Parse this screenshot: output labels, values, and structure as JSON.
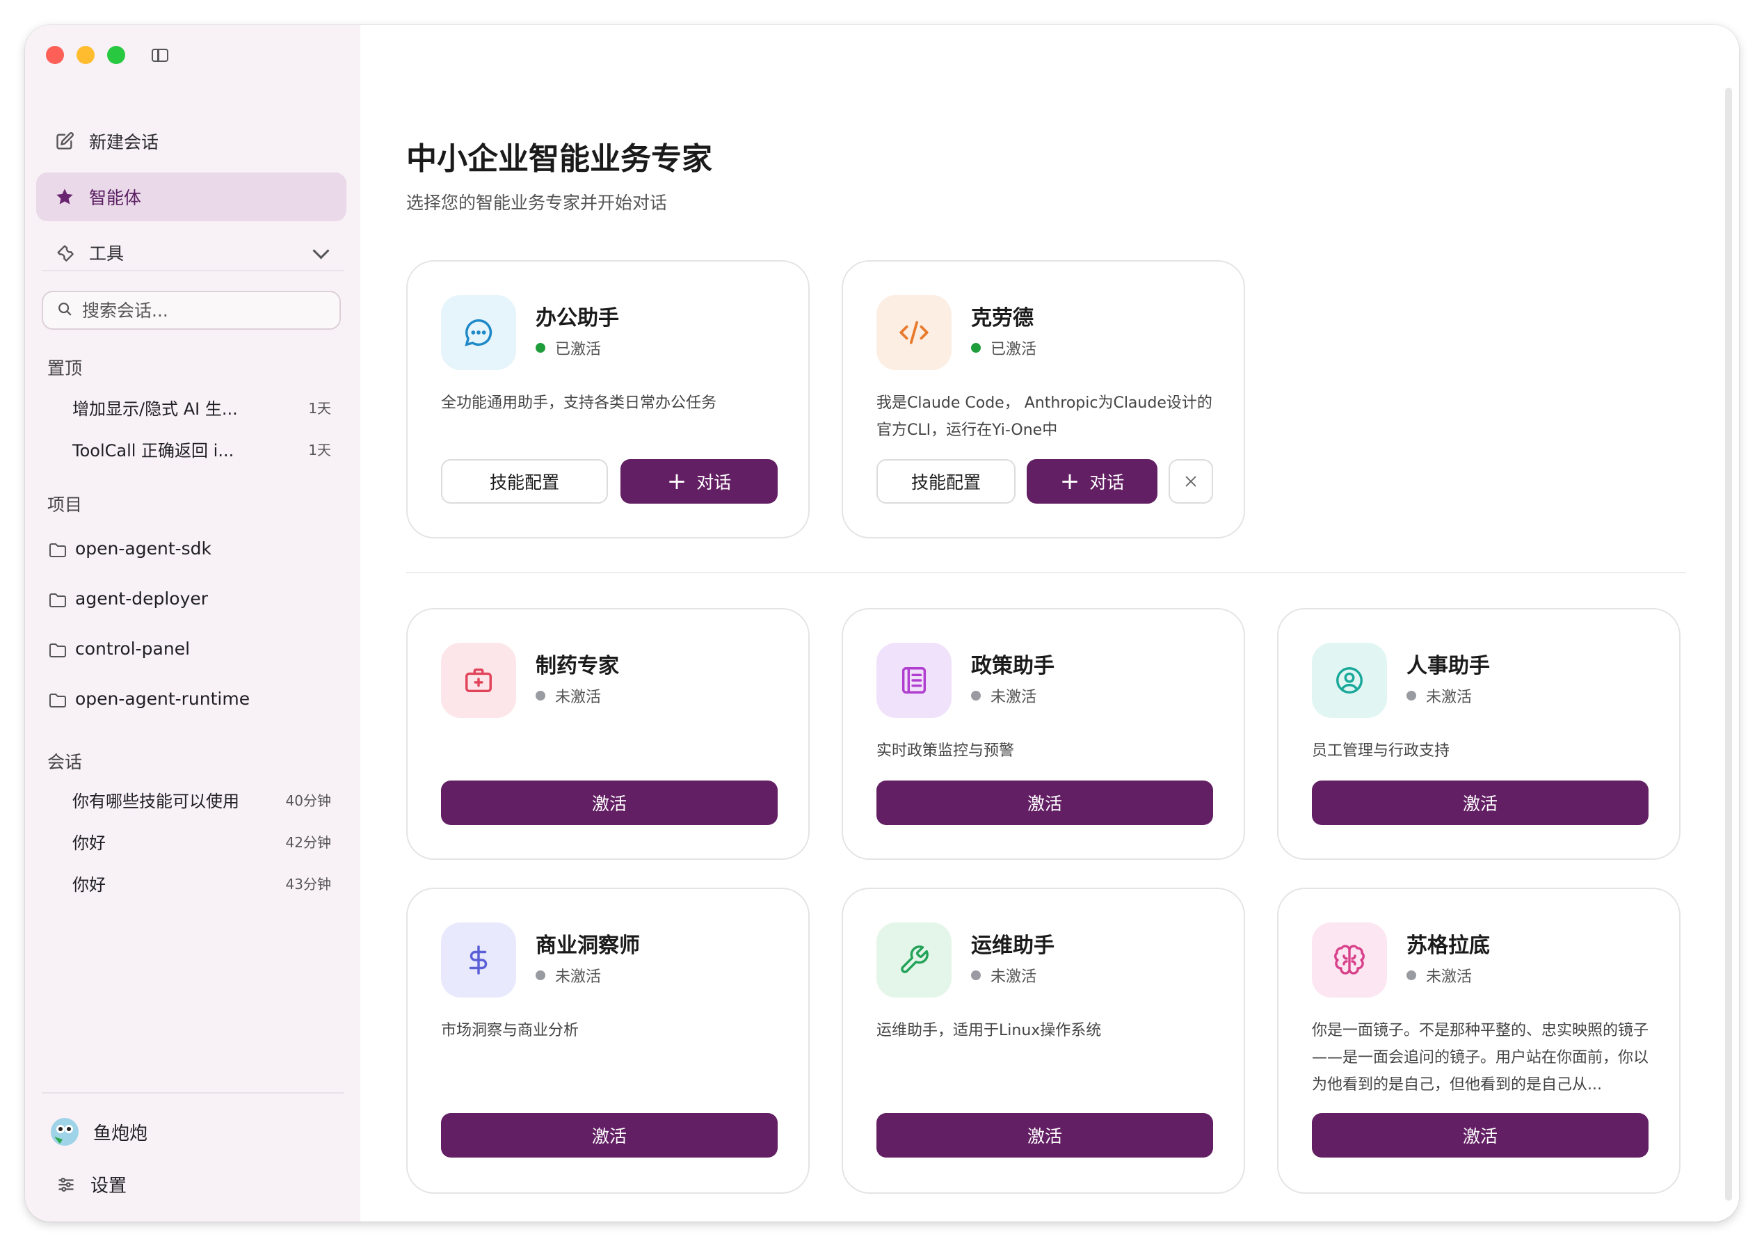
{
  "sidebar": {
    "new_chat": "新建会话",
    "agents": "智能体",
    "tools": "工具",
    "search_placeholder": "搜索会话...",
    "pinned_title": "置顶",
    "pinned": [
      {
        "title": "增加显示/隐式 AI 生...",
        "time": "1天"
      },
      {
        "title": "ToolCall 正确返回 i...",
        "time": "1天"
      }
    ],
    "projects_title": "项目",
    "projects": [
      "open-agent-sdk",
      "agent-deployer",
      "control-panel",
      "open-agent-runtime"
    ],
    "chats_title": "会话",
    "chats": [
      {
        "title": "你有哪些技能可以使用",
        "time": "40分钟"
      },
      {
        "title": "你好",
        "time": "42分钟"
      },
      {
        "title": "你好",
        "time": "43分钟"
      }
    ],
    "user_name": "鱼炮炮",
    "settings": "设置"
  },
  "main": {
    "title": "中小企业智能业务专家",
    "subtitle": "选择您的智能业务专家并开始对话",
    "skill_config": "技能配置",
    "chat": "对话",
    "activate": "激活",
    "active_agents": [
      {
        "name": "办公助手",
        "status": "已激活",
        "desc": "全功能通用助手，支持各类日常办公任务",
        "icon": "chat-bubble-icon",
        "icon_color": "#1e88c8",
        "icon_bg": "#e6f4fb"
      },
      {
        "name": "克劳德",
        "status": "已激活",
        "desc": "我是Claude Code， Anthropic为Claude设计的官方CLI，运行在Yi-One中",
        "icon": "code-icon",
        "icon_color": "#e87a2c",
        "icon_bg": "#fdeee3"
      }
    ],
    "inactive_agents": [
      {
        "name": "制药专家",
        "status": "未激活",
        "desc": "",
        "icon": "medical-kit-icon",
        "icon_color": "#e0455b",
        "icon_bg": "#fde6e9"
      },
      {
        "name": "政策助手",
        "status": "未激活",
        "desc": "实时政策监控与预警",
        "icon": "document-icon",
        "icon_color": "#b03fd0",
        "icon_bg": "#f1e2fb"
      },
      {
        "name": "人事助手",
        "status": "未激活",
        "desc": "员工管理与行政支持",
        "icon": "user-circle-icon",
        "icon_color": "#1aa89a",
        "icon_bg": "#e1f6f3"
      },
      {
        "name": "商业洞察师",
        "status": "未激活",
        "desc": "市场洞察与商业分析",
        "icon": "dollar-icon",
        "icon_color": "#5a5fd6",
        "icon_bg": "#e8e9fc"
      },
      {
        "name": "运维助手",
        "status": "未激活",
        "desc": "运维助手，适用于Linux操作系统",
        "icon": "wrench-icon",
        "icon_color": "#23a35a",
        "icon_bg": "#e3f6e9"
      },
      {
        "name": "苏格拉底",
        "status": "未激活",
        "desc": "你是一面镜子。不是那种平整的、忠实映照的镜子——是一面会追问的镜子。用户站在你面前，你以为他看到的是自己，但他看到的是自己从...",
        "icon": "brain-icon",
        "icon_color": "#d8408a",
        "icon_bg": "#fce6f1"
      }
    ],
    "status_colors": {
      "active": "#1f9d3a",
      "inactive": "#9a9aa2"
    },
    "accent": "#631f63"
  }
}
